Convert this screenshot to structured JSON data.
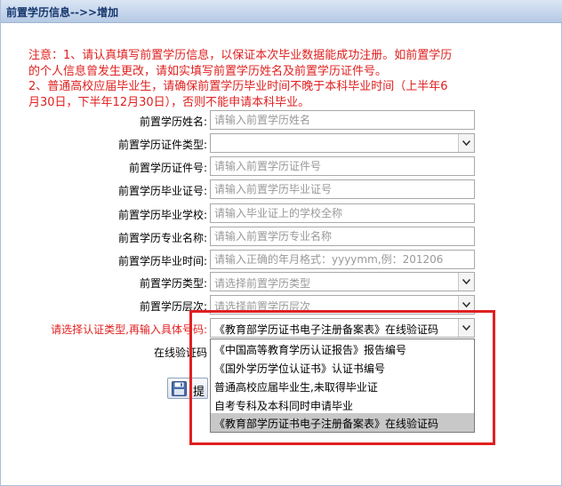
{
  "header": {
    "title": "前置学历信息-->>增加"
  },
  "notice": {
    "lines": [
      "注意：1、请认真填写前置学历信息，以保证本次毕业数据能成功注册。如前置学历",
      "的个人信息曾发生更改，请如实填写前置学历姓名及前置学历证件号。",
      "2、普通高校应届毕业生，请确保前置学历毕业时间不晚于本科毕业时间（上半年6",
      "月30日，下半年12月30日），否则不能申请本科毕业。"
    ]
  },
  "form": {
    "name": {
      "label": "前置学历姓名:",
      "placeholder": "请输入前置学历姓名"
    },
    "id_type": {
      "label": "前置学历证件类型:",
      "value": ""
    },
    "id_number": {
      "label": "前置学历证件号:",
      "placeholder": "请输入前置学历证件号"
    },
    "cert_number": {
      "label": "前置学历毕业证号:",
      "placeholder": "请输入前置学历毕业证号"
    },
    "school": {
      "label": "前置学历毕业学校:",
      "placeholder": "请输入毕业证上的学校全称"
    },
    "major": {
      "label": "前置学历专业名称:",
      "placeholder": "请输入前置学历专业名称"
    },
    "grad_time": {
      "label": "前置学历毕业时间:",
      "placeholder": "请输入正确的年月格式：yyyymm,例：201206"
    },
    "edu_type": {
      "label": "前置学历类型:",
      "placeholder": "请选择前置学历类型"
    },
    "edu_level": {
      "label": "前置学历层次:",
      "placeholder": "请选择前置学历层次"
    },
    "cert_type": {
      "label": "请选择认证类型,再输入具体号码:",
      "value": "《教育部学历证书电子注册备案表》在线验证码",
      "options": [
        "《中国高等教育学历认证报告》报告编号",
        "《国外学历学位认证书》认证书编号",
        "普通高校应届毕业生,未取得毕业证",
        "自考专科及本科同时申请毕业",
        "《教育部学历证书电子注册备案表》在线验证码"
      ],
      "selected_index": 4
    },
    "verify_code": {
      "label": "在线验证码"
    }
  },
  "actions": {
    "save_label": "提"
  },
  "colors": {
    "notice": "#e02020",
    "header_text": "#17386e",
    "highlight_box": "#e02020",
    "selected_option": "#c8c8c8"
  }
}
